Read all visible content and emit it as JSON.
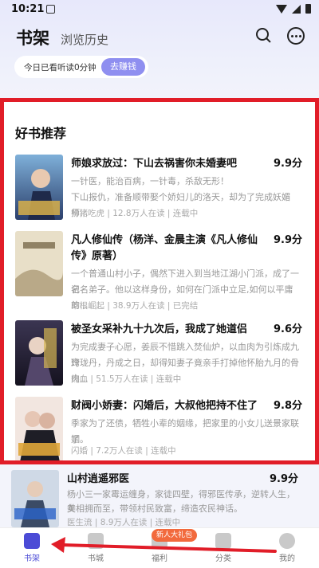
{
  "status": {
    "time": "10:21"
  },
  "header": {
    "tab_active": "书架",
    "tab_history": "浏览历史"
  },
  "reading": {
    "text": "今日已看听读0分钟",
    "button": "去赚钱"
  },
  "recommend": {
    "title": "好书推荐",
    "books": [
      {
        "title": "师娘求放过：下山去祸害你未婚妻吧",
        "score": "9.9分",
        "desc1": "一针医，能治百病，一针毒，杀敌无形！",
        "desc2": "下山报仇，准备顺带娶个娇妇儿的洛天，却为了完成妖媚师...",
        "meta": "扮猪吃虎 | 12.8万人在读 | 连载中"
      },
      {
        "title": "凡人修仙传（杨洋、金晨主演《凡人修仙传》原著）",
        "score": "9.9分",
        "desc1": "一个普通山村小子，偶然下进入到当地江湖小门派，成了一名",
        "desc2": "记名弟子。他以这样身份，如何在门派中立足,如何以平庸的...",
        "meta": "草根崛起 | 38.9万人在读 | 已完结"
      },
      {
        "title": "被圣女采补九十九次后，我成了她道侣",
        "score": "9.6分",
        "desc1": "为完成妻子心愿，姜辰不惜跳入焚仙炉，以血肉为引炼成九窍",
        "desc2": "玲珑丹，丹成之日，却得知妻子竟亲手打掉他怀胎九月的骨肉...",
        "meta": "热血 | 51.5万人在读 | 连载中"
      },
      {
        "title": "财阀小娇妻：闪婚后，大叔他把持不住了",
        "score": "9.8分",
        "desc1": "季家为了还债，牺牲小辈的姻缘，把家里的小女儿送景家联姻",
        "desc2": "了。",
        "meta": "闪婚 | 7.2万人在读 | 连载中"
      }
    ]
  },
  "outside_book": {
    "title": "山村逍遥邪医",
    "score": "9.9分",
    "desc1": "杨小三一家霉运缠身，家徒四壁，得邪医传承，逆转人生，美",
    "desc2": "女相拥而至，带领村民致富，缔造农民神话。",
    "meta": "医生流 | 8.9万人在读 | 连载中"
  },
  "nav": {
    "items": [
      "书架",
      "书城",
      "福利",
      "分类",
      "我的"
    ],
    "promo": "新人大礼包"
  },
  "colors": {
    "accent": "#4b4bd6",
    "highlight_border": "#e11d28",
    "arrow": "#e11d28"
  }
}
